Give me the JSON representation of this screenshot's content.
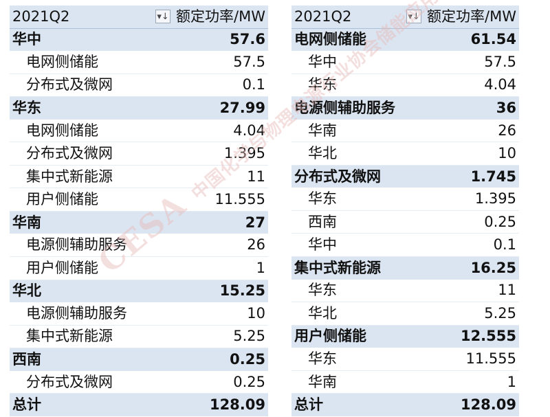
{
  "left_table": {
    "header": {
      "row_label": "2021Q2",
      "value_label": "额定功率/MW"
    },
    "rows": [
      {
        "type": "grp",
        "label": "华中",
        "value": "57.6"
      },
      {
        "type": "child",
        "label": "电网侧储能",
        "value": "57.5"
      },
      {
        "type": "child",
        "label": "分布式及微网",
        "value": "0.1"
      },
      {
        "type": "grp",
        "label": "华东",
        "value": "27.99"
      },
      {
        "type": "child",
        "label": "电网侧储能",
        "value": "4.04"
      },
      {
        "type": "child",
        "label": "分布式及微网",
        "value": "1.395"
      },
      {
        "type": "child",
        "label": "集中式新能源",
        "value": "11"
      },
      {
        "type": "child",
        "label": "用户侧储能",
        "value": "11.555"
      },
      {
        "type": "grp",
        "label": "华南",
        "value": "27"
      },
      {
        "type": "child",
        "label": "电源侧辅助服务",
        "value": "26"
      },
      {
        "type": "child",
        "label": "用户侧储能",
        "value": "1"
      },
      {
        "type": "grp",
        "label": "华北",
        "value": "15.25"
      },
      {
        "type": "child",
        "label": "电源侧辅助服务",
        "value": "10"
      },
      {
        "type": "child",
        "label": "集中式新能源",
        "value": "5.25"
      },
      {
        "type": "grp",
        "label": "西南",
        "value": "0.25"
      },
      {
        "type": "child",
        "label": "分布式及微网",
        "value": "0.25"
      },
      {
        "type": "total",
        "label": "总计",
        "value": "128.09"
      }
    ]
  },
  "right_table": {
    "header": {
      "row_label": "2021Q2",
      "value_label": "额定功率/MW"
    },
    "rows": [
      {
        "type": "grp",
        "label": "电网侧储能",
        "value": "61.54"
      },
      {
        "type": "child",
        "label": "华中",
        "value": "57.5"
      },
      {
        "type": "child",
        "label": "华东",
        "value": "4.04"
      },
      {
        "type": "grp",
        "label": "电源侧辅助服务",
        "value": "36"
      },
      {
        "type": "child",
        "label": "华南",
        "value": "26"
      },
      {
        "type": "child",
        "label": "华北",
        "value": "10"
      },
      {
        "type": "grp",
        "label": "分布式及微网",
        "value": "1.745"
      },
      {
        "type": "child",
        "label": "华东",
        "value": "1.395"
      },
      {
        "type": "child",
        "label": "西南",
        "value": "0.25"
      },
      {
        "type": "child",
        "label": "华中",
        "value": "0.1"
      },
      {
        "type": "grp",
        "label": "集中式新能源",
        "value": "16.25"
      },
      {
        "type": "child",
        "label": "华东",
        "value": "11"
      },
      {
        "type": "child",
        "label": "华北",
        "value": "5.25"
      },
      {
        "type": "grp",
        "label": "用户侧储能",
        "value": "12.555"
      },
      {
        "type": "child",
        "label": "华东",
        "value": "11.555"
      },
      {
        "type": "child",
        "label": "华南",
        "value": "1"
      },
      {
        "type": "total",
        "label": "总计",
        "value": "128.09"
      }
    ]
  },
  "dropdown_glyph": "▾↓",
  "watermark": {
    "main": "CESA",
    "cn": "中国化学与物理电源行业协会储能应用分会"
  }
}
